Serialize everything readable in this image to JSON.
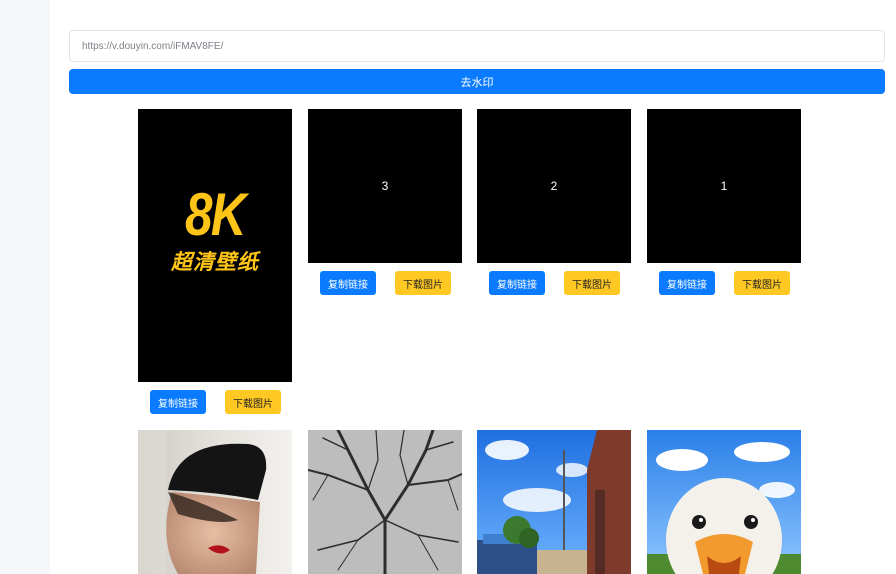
{
  "form": {
    "url_value": "https://v.douyin.com/iFMAV8FE/",
    "submit_label": "去水印"
  },
  "actions": {
    "copy_label": "复制链接",
    "download_label": "下载图片"
  },
  "cover": {
    "title": "8K",
    "subtitle": "超清壁纸"
  },
  "items": [
    {
      "label": "3"
    },
    {
      "label": "2"
    },
    {
      "label": "1"
    }
  ],
  "photos": [
    {
      "icon": "portrait-photo"
    },
    {
      "icon": "tree-branches-photo"
    },
    {
      "icon": "street-sky-photo"
    },
    {
      "icon": "duck-photo"
    }
  ],
  "colors": {
    "primary": "#0a7bff",
    "warning": "#ffc823",
    "logo_gold": "#ffc418",
    "sidebar_bg": "#f4f6fa"
  }
}
